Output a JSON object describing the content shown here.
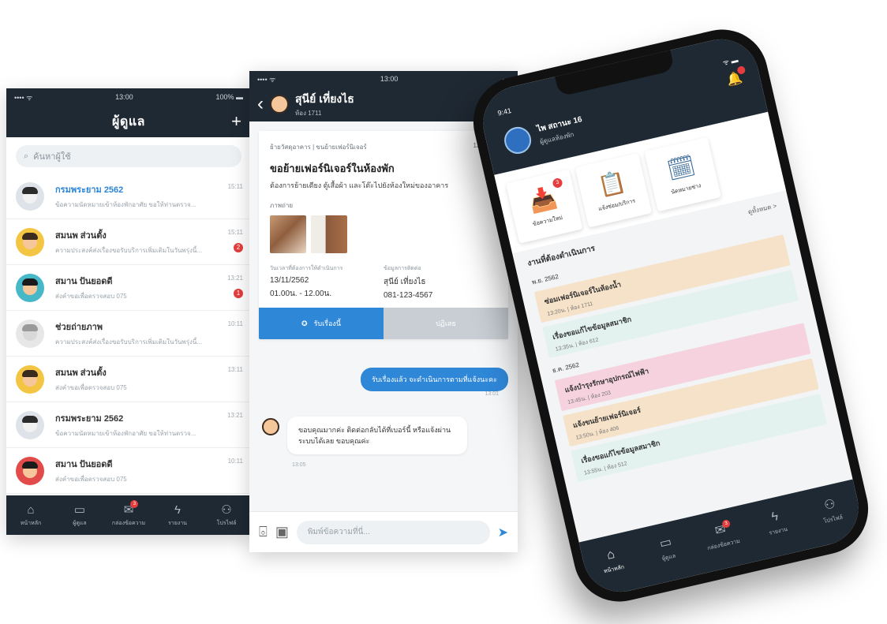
{
  "list_screen": {
    "status": {
      "carrier": "•••• ᯤ",
      "time": "13:00",
      "battery": "100% ▬"
    },
    "title": "ผู้ดูแล",
    "add_icon": "plus-icon",
    "search_placeholder": "ค้นหาผู้ใช้",
    "contacts": [
      {
        "name": "กรมพระยาม 2562",
        "sub": "ข้อความนัดหมายเข้าห้องพักอาศัย ขอให้ท่านตรวจ...",
        "time": "15:11",
        "badge": "",
        "highlight": true,
        "face": "#f1f1f1",
        "hair": "#2b2b2b",
        "bg": "#dde3e8"
      },
      {
        "name": "สมนพ ส่วนตั้ง",
        "sub": "ความประสงค์ส่งเรื่องขอรับบริการเพิ่มเติมในวันพรุ่งนี้...",
        "time": "15:11",
        "badge": "2",
        "highlight": false,
        "face": "#f6c79b",
        "hair": "#3b2a1e",
        "bg": "#f4c542"
      },
      {
        "name": "สมาน ปันยอดดี",
        "sub": "ส่งคำขอเพื่อตรวจสอบ 075",
        "time": "13:21",
        "badge": "1",
        "highlight": false,
        "face": "#f6c79b",
        "hair": "#1b1b1b",
        "bg": "#46b8c8"
      },
      {
        "name": "ช่วยถ่ายภาพ",
        "sub": "ความประสงค์ส่งเรื่องขอรับบริการเพิ่มเติมในวันพรุ่งนี้...",
        "time": "10:11",
        "badge": "",
        "highlight": false,
        "face": "#d8d8d8",
        "hair": "#9a9a9a",
        "bg": "#e7e7e7"
      },
      {
        "name": "สมนพ ส่วนตั้ง",
        "sub": "ส่งคำขอเพื่อตรวจสอบ 075",
        "time": "13:11",
        "badge": "",
        "highlight": false,
        "face": "#f6c79b",
        "hair": "#3b2a1e",
        "bg": "#f4c542"
      },
      {
        "name": "กรมพระยาม 2562",
        "sub": "ข้อความนัดหมายเข้าห้องพักอาศัย ขอให้ท่านตรวจ...",
        "time": "13:21",
        "badge": "",
        "highlight": false,
        "face": "#f1f1f1",
        "hair": "#2b2b2b",
        "bg": "#dde3e8"
      },
      {
        "name": "สมาน ปันยอดดี",
        "sub": "ส่งคำขอเพื่อตรวจสอบ 075",
        "time": "10:11",
        "badge": "",
        "highlight": false,
        "face": "#f6c79b",
        "hair": "#1b1b1b",
        "bg": "#e34b4b"
      }
    ],
    "tabs": [
      {
        "label": "หน้าหลัก",
        "icon": "home-icon",
        "glyph": "⌂",
        "badge": ""
      },
      {
        "label": "ผู้ดูแล",
        "icon": "monitor-icon",
        "glyph": "▭",
        "badge": ""
      },
      {
        "label": "กล่องข้อความ",
        "icon": "mail-icon",
        "glyph": "✉",
        "badge": "3"
      },
      {
        "label": "รายงาน",
        "icon": "bolt-icon",
        "glyph": "ϟ",
        "badge": ""
      },
      {
        "label": "โปรไฟล์",
        "icon": "user-icon",
        "glyph": "⚇",
        "badge": ""
      }
    ]
  },
  "chat_screen": {
    "status": {
      "carrier": "•••• ᯤ",
      "time": "13:00",
      "battery": "▬"
    },
    "contact_name": "สุนีย์ เที่ยงไธ",
    "contact_id": "ห้อง 1711",
    "card": {
      "type": "ย้ายวัสดุอาคาร | ขนย้ายเฟอร์นิเจอร์",
      "date": "13/11/62",
      "title": "ขอย้ายเฟอร์นิเจอร์ในห้องพัก",
      "desc": "ต้องการย้ายเตียง ตู้เสื้อผ้า และโต๊ะไปยังห้องใหม่ของอาคาร",
      "photos_label": "ภาพถ่าย",
      "date_label": "วันเวลาที่ต้องการให้ดำเนินการ",
      "date_value": "13/11/2562",
      "time_value": "01.00น. - 12.00น.",
      "contact_label": "ข้อมูลการติดต่อ",
      "contact_value": "สุนีย์ เที่ยงไธ",
      "phone_value": "081-123-4567",
      "accept_label": "รับเรื่องนี้",
      "reject_label": "ปฏิเสธ"
    },
    "out_message": "รับเรื่องแล้ว จะดำเนินการตามที่แจ้งนะคะ",
    "out_time": "13:01",
    "in_message": "ขอบคุณมากค่ะ ติดต่อกลับได้ที่เบอร์นี้ หรือแจ้งผ่านระบบได้เลย ขอบคุณค่ะ",
    "in_time": "13:05",
    "input_placeholder": "พิมพ์ข้อความที่นี่...",
    "camera_icon": "camera-icon",
    "gallery_icon": "image-icon",
    "send_icon": "send-icon"
  },
  "home_screen": {
    "status": {
      "time": "9:41",
      "signal": "ᯤ ▬"
    },
    "user_name": "ไพ สถานะ 16",
    "user_role": "ผู้ดูแลห้องพัก",
    "menu": [
      {
        "label": "ข้อความใหม่",
        "icon": "inbox-icon",
        "glyph": "📥",
        "badge": "3"
      },
      {
        "label": "แจ้งซ่อม/บริการ",
        "icon": "clipboard-icon",
        "glyph": "📋",
        "badge": ""
      },
      {
        "label": "นัดหมายช่าง",
        "icon": "calendar-icon",
        "glyph": "🗓",
        "badge": ""
      }
    ],
    "section_title": "งานที่ต้องดำเนินการ",
    "section_link": "ดูทั้งหมด >",
    "groups": [
      {
        "month": "พ.ย. 2562",
        "items": [
          {
            "title": "ซ่อมเฟอร์นิเจอร์ในห้องน้ำ",
            "sub": "13:20น. | ห้อง 1711",
            "color": "#f6e2c8"
          },
          {
            "title": "เรื่องขอแก้ไขข้อมูลสมาชิก",
            "sub": "13:35น. | ห้อง 612",
            "color": "#e3f2ef"
          }
        ]
      },
      {
        "month": "ธ.ค. 2562",
        "items": [
          {
            "title": "แจ้งบำรุงรักษาอุปกรณ์ไฟฟ้า",
            "sub": "13:45น. | ห้อง 203",
            "color": "#f6d2de"
          },
          {
            "title": "แจ้งขนย้ายเฟอร์นิเจอร์",
            "sub": "13:50น. | ห้อง 406",
            "color": "#f6e2c8"
          },
          {
            "title": "เรื่องขอแก้ไขข้อมูลสมาชิก",
            "sub": "13:55น. | ห้อง 512",
            "color": "#e3f2ef"
          }
        ]
      }
    ],
    "tabs": [
      {
        "label": "หน้าหลัก",
        "icon": "home-icon",
        "glyph": "⌂",
        "badge": "",
        "active": true
      },
      {
        "label": "ผู้ดูแล",
        "icon": "monitor-icon",
        "glyph": "▭",
        "badge": "",
        "active": false
      },
      {
        "label": "กล่องข้อความ",
        "icon": "mail-icon",
        "glyph": "✉",
        "badge": "3",
        "active": false
      },
      {
        "label": "รายงาน",
        "icon": "bolt-icon",
        "glyph": "ϟ",
        "badge": "",
        "active": false
      },
      {
        "label": "โปรไฟล์",
        "icon": "user-icon",
        "glyph": "⚇",
        "badge": "",
        "active": false
      }
    ]
  },
  "colors": {
    "header": "#1f2933",
    "accent": "#2f87d8",
    "badge": "#e53d3d"
  }
}
